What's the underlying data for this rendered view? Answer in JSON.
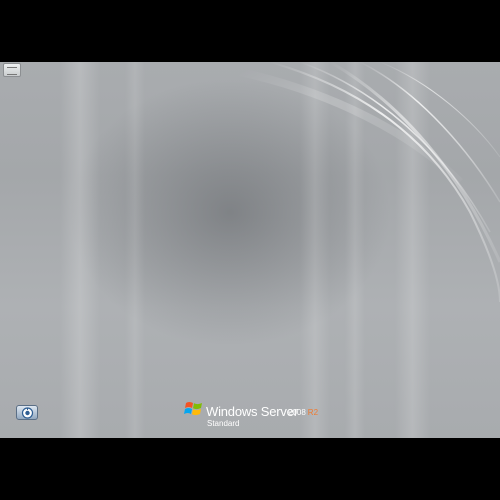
{
  "screen": {
    "background_color": "#000000",
    "desktop_color": "#a8abae"
  },
  "system_icon": {
    "icon": "computer-window-icon"
  },
  "ease_of_access": {
    "icon": "ease-of-access-icon",
    "accent": "#3a6ea5"
  },
  "branding": {
    "logo_icon": "windows-flag-icon",
    "product_name": "Windows Server",
    "version": "2008",
    "version_suffix": "R2",
    "edition": "Standard",
    "suffix_color": "#f07a30"
  }
}
